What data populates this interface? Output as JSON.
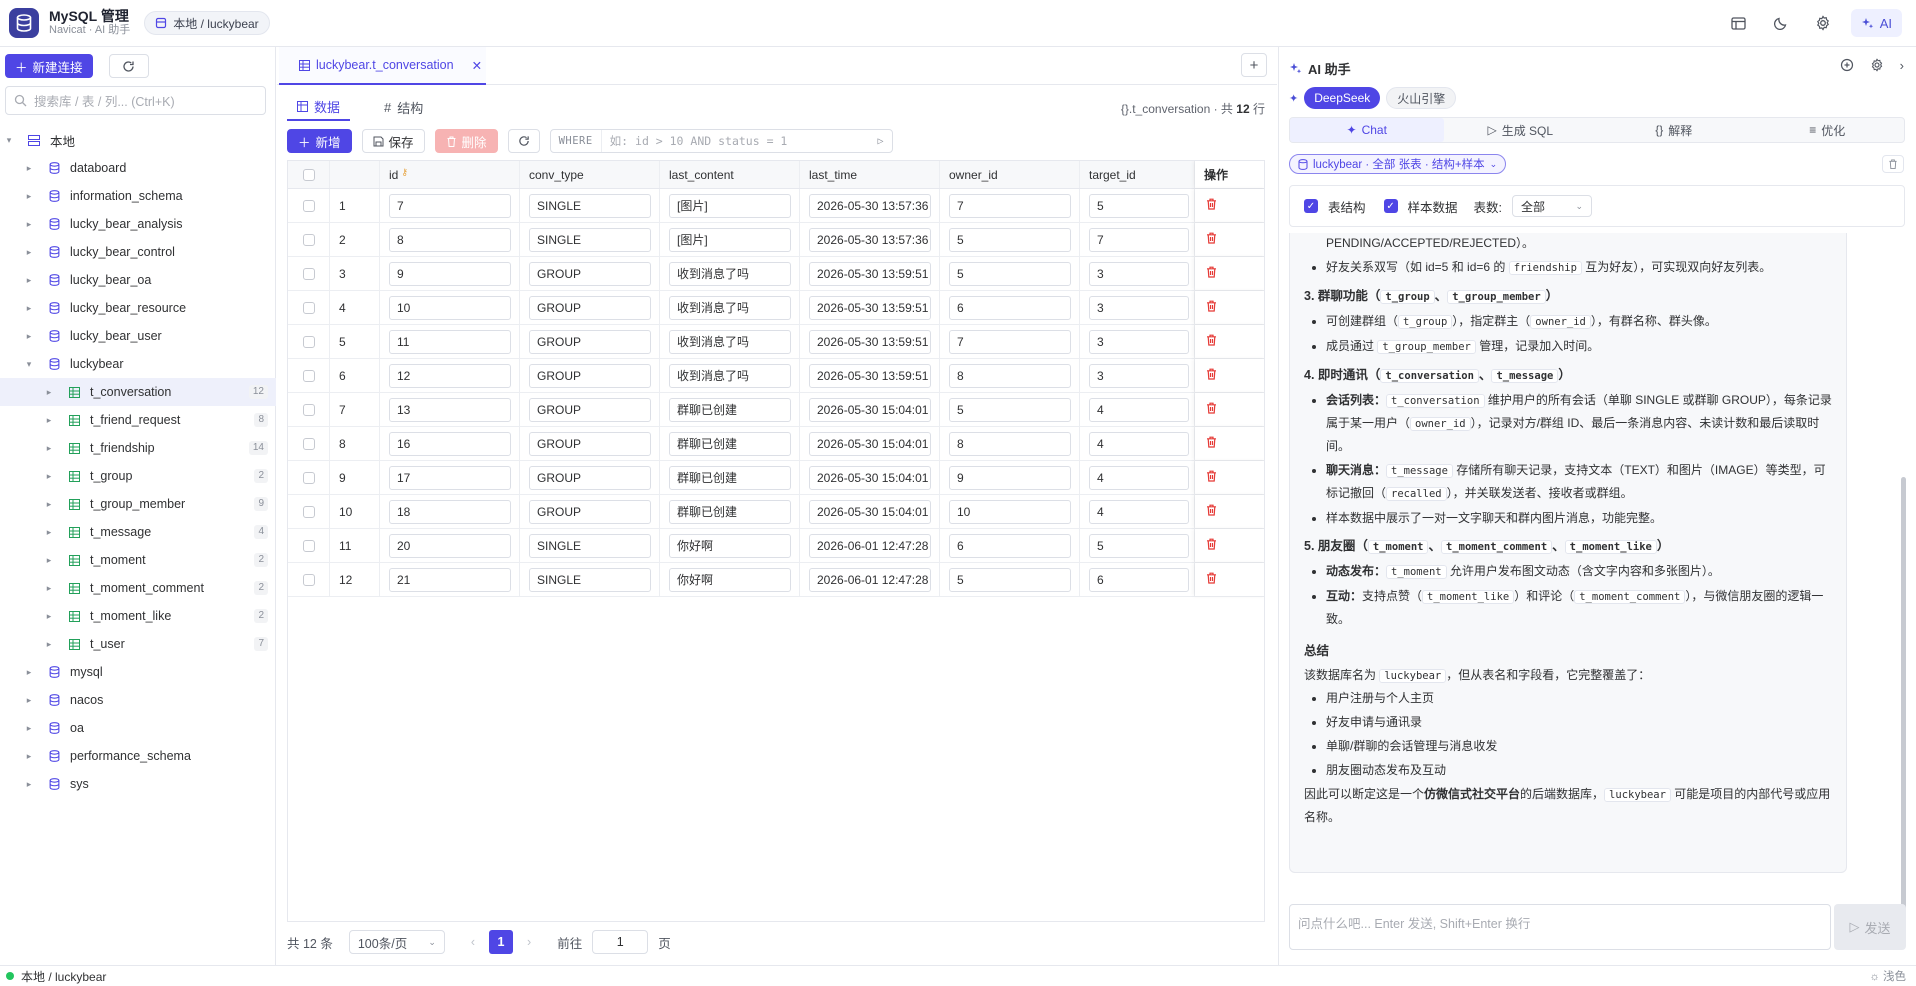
{
  "app": {
    "title": "MySQL 管理",
    "subtitle": "Navicat · AI 助手",
    "connection_crumb": "本地 / luckybear",
    "ai_button": "AI"
  },
  "sidebar": {
    "new_connection": "新建连接",
    "search_placeholder": "搜索库 / 表 / 列... (Ctrl+K)",
    "root": "本地",
    "databases_before": [
      "databoard",
      "information_schema",
      "lucky_bear_analysis",
      "lucky_bear_control",
      "lucky_bear_oa",
      "lucky_bear_resource",
      "lucky_bear_user"
    ],
    "open_db": "luckybear",
    "tables": [
      {
        "name": "t_conversation",
        "count": "12"
      },
      {
        "name": "t_friend_request",
        "count": "8"
      },
      {
        "name": "t_friendship",
        "count": "14"
      },
      {
        "name": "t_group",
        "count": "2"
      },
      {
        "name": "t_group_member",
        "count": "9"
      },
      {
        "name": "t_message",
        "count": "4"
      },
      {
        "name": "t_moment",
        "count": "2"
      },
      {
        "name": "t_moment_comment",
        "count": "2"
      },
      {
        "name": "t_moment_like",
        "count": "2"
      },
      {
        "name": "t_user",
        "count": "7"
      }
    ],
    "databases_after": [
      "mysql",
      "nacos",
      "oa",
      "performance_schema",
      "sys"
    ]
  },
  "editor": {
    "tab_label": "luckybear.t_conversation",
    "subtab_data": "数据",
    "subtab_structure": "结构",
    "table_info_prefix": "{}.t_conversation · 共",
    "table_info_count": "12",
    "table_info_suffix": "行",
    "btn_new": "新增",
    "btn_save": "保存",
    "btn_delete": "删除",
    "where_label": "WHERE",
    "where_placeholder": "如: id > 10 AND status = 1",
    "columns": [
      "id",
      "conv_type",
      "last_content",
      "last_time",
      "owner_id",
      "target_id",
      "操作"
    ],
    "rows": [
      {
        "n": "1",
        "id": "7",
        "conv_type": "SINGLE",
        "last_content": "[图片]",
        "last_time": "2026-05-30 13:57:36",
        "owner_id": "7",
        "target_id": "5"
      },
      {
        "n": "2",
        "id": "8",
        "conv_type": "SINGLE",
        "last_content": "[图片]",
        "last_time": "2026-05-30 13:57:36",
        "owner_id": "5",
        "target_id": "7"
      },
      {
        "n": "3",
        "id": "9",
        "conv_type": "GROUP",
        "last_content": "收到消息了吗",
        "last_time": "2026-05-30 13:59:51",
        "owner_id": "5",
        "target_id": "3"
      },
      {
        "n": "4",
        "id": "10",
        "conv_type": "GROUP",
        "last_content": "收到消息了吗",
        "last_time": "2026-05-30 13:59:51",
        "owner_id": "6",
        "target_id": "3"
      },
      {
        "n": "5",
        "id": "11",
        "conv_type": "GROUP",
        "last_content": "收到消息了吗",
        "last_time": "2026-05-30 13:59:51",
        "owner_id": "7",
        "target_id": "3"
      },
      {
        "n": "6",
        "id": "12",
        "conv_type": "GROUP",
        "last_content": "收到消息了吗",
        "last_time": "2026-05-30 13:59:51",
        "owner_id": "8",
        "target_id": "3"
      },
      {
        "n": "7",
        "id": "13",
        "conv_type": "GROUP",
        "last_content": "群聊已创建",
        "last_time": "2026-05-30 15:04:01",
        "owner_id": "5",
        "target_id": "4"
      },
      {
        "n": "8",
        "id": "16",
        "conv_type": "GROUP",
        "last_content": "群聊已创建",
        "last_time": "2026-05-30 15:04:01",
        "owner_id": "8",
        "target_id": "4"
      },
      {
        "n": "9",
        "id": "17",
        "conv_type": "GROUP",
        "last_content": "群聊已创建",
        "last_time": "2026-05-30 15:04:01",
        "owner_id": "9",
        "target_id": "4"
      },
      {
        "n": "10",
        "id": "18",
        "conv_type": "GROUP",
        "last_content": "群聊已创建",
        "last_time": "2026-05-30 15:04:01",
        "owner_id": "10",
        "target_id": "4"
      },
      {
        "n": "11",
        "id": "20",
        "conv_type": "SINGLE",
        "last_content": "你好啊",
        "last_time": "2026-06-01 12:47:28",
        "owner_id": "6",
        "target_id": "5"
      },
      {
        "n": "12",
        "id": "21",
        "conv_type": "SINGLE",
        "last_content": "你好啊",
        "last_time": "2026-06-01 12:47:28",
        "owner_id": "5",
        "target_id": "6"
      }
    ],
    "pager": {
      "total": "共 12 条",
      "page_size": "100条/页",
      "current": "1",
      "goto_label": "前往",
      "goto_value": "1",
      "page_unit": "页"
    }
  },
  "ai": {
    "title": "AI 助手",
    "models": [
      "DeepSeek",
      "火山引擎"
    ],
    "modes": [
      "Chat",
      "生成 SQL",
      "解释",
      "优化"
    ],
    "context_chip": "luckybear · 全部 张表 · 结构+样本",
    "opt_schema": "表结构",
    "opt_sample": "样本数据",
    "opt_tables_label": "表数:",
    "opt_tables_value": "全部",
    "input_placeholder": "问点什么吧... Enter 发送, Shift+Enter 换行",
    "send": "发送"
  },
  "status": {
    "connection": "本地 / luckybear",
    "theme": "浅色"
  },
  "colors": {
    "accent": "#4f46e5",
    "danger": "#e53935",
    "online": "#22c55e"
  }
}
